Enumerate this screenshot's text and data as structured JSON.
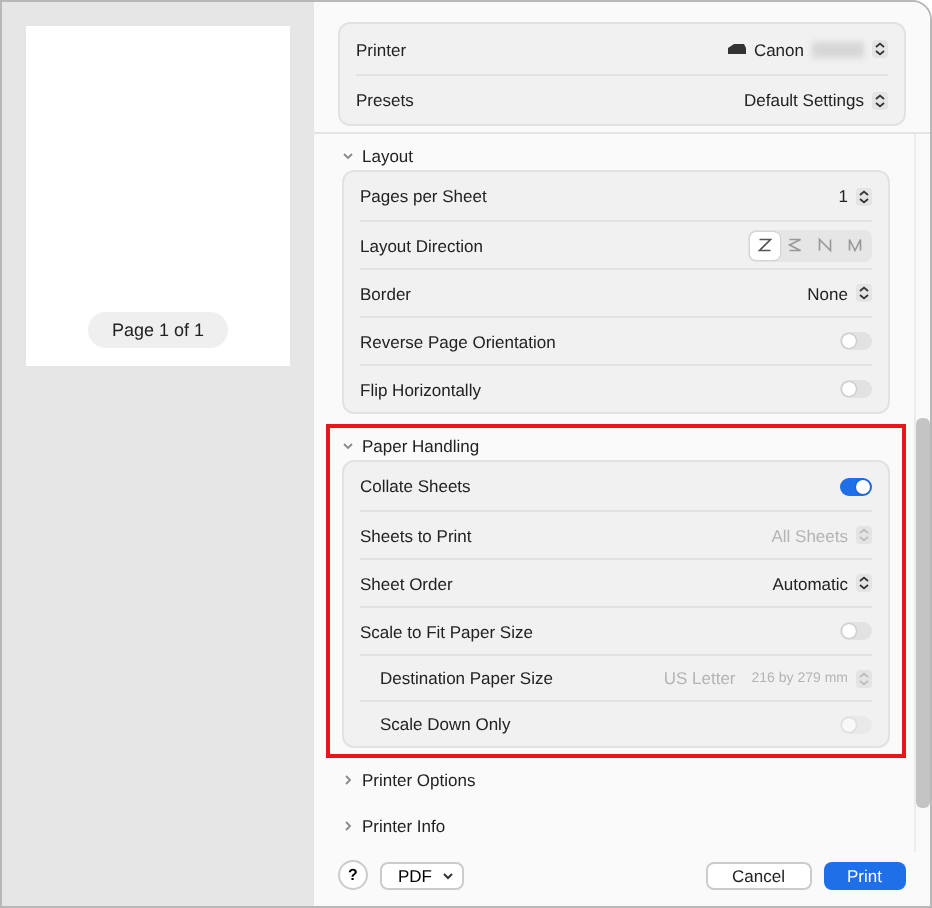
{
  "preview": {
    "page_label": "Page 1 of 1"
  },
  "header": [
    {
      "kind": "printer",
      "label": "Printer",
      "value": "Canon"
    },
    {
      "kind": "popup",
      "label": "Presets",
      "value": "Default Settings"
    }
  ],
  "sections": [
    {
      "title": "Layout",
      "expanded": true,
      "highlighted": false,
      "rows": [
        {
          "kind": "popup",
          "label": "Pages per Sheet",
          "value": "1",
          "disabled": false
        },
        {
          "kind": "segments",
          "label": "Layout Direction",
          "segments": [
            {
              "selected": true
            },
            {
              "selected": false
            },
            {
              "selected": false
            },
            {
              "selected": false
            }
          ]
        },
        {
          "kind": "popup",
          "label": "Border",
          "value": "None",
          "disabled": false
        },
        {
          "kind": "toggle",
          "label": "Reverse Page Orientation",
          "on": false,
          "disabled": false
        },
        {
          "kind": "toggle",
          "label": "Flip Horizontally",
          "on": false,
          "disabled": false
        }
      ]
    },
    {
      "title": "Paper Handling",
      "expanded": true,
      "highlighted": true,
      "rows": [
        {
          "kind": "toggle",
          "label": "Collate Sheets",
          "on": true,
          "disabled": false
        },
        {
          "kind": "popup",
          "label": "Sheets to Print",
          "value": "All Sheets",
          "disabled": true
        },
        {
          "kind": "popup",
          "label": "Sheet Order",
          "value": "Automatic",
          "disabled": false
        },
        {
          "kind": "toggle",
          "label": "Scale to Fit Paper Size",
          "on": false,
          "disabled": false,
          "children": [
            {
              "kind": "popup",
              "label": "Destination Paper Size",
              "value": "US Letter",
              "detail": "216 by 279 mm",
              "disabled": true
            },
            {
              "kind": "toggle",
              "label": "Scale Down Only",
              "on": false,
              "disabled": true
            }
          ]
        }
      ]
    },
    {
      "title": "Printer Options",
      "expanded": false,
      "highlighted": false
    },
    {
      "title": "Printer Info",
      "expanded": false,
      "highlighted": false
    }
  ],
  "footer": {
    "help": "?",
    "pdf": "PDF",
    "cancel": "Cancel",
    "print": "Print"
  }
}
